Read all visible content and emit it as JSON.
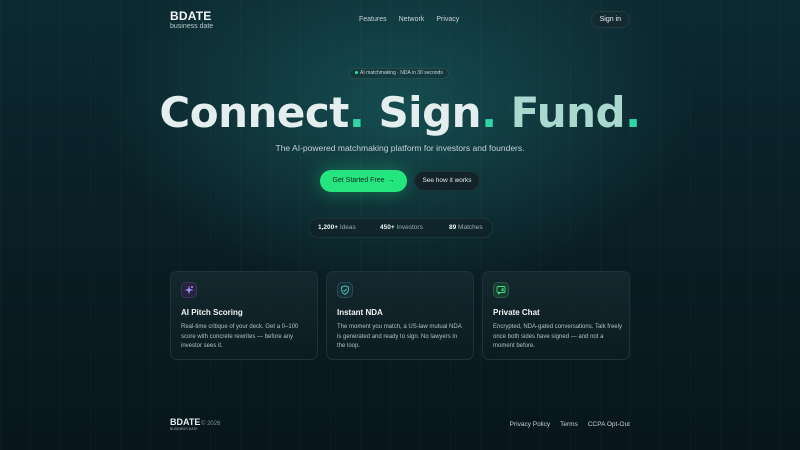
{
  "nav": {
    "logo": "BDATE",
    "logo_sub": "business date",
    "links": [
      "Features",
      "Network",
      "Privacy"
    ],
    "signin": "Sign in"
  },
  "badge": "AI matchmaking · NDA in 30 seconds",
  "hero": {
    "words": [
      "Connect",
      "Sign",
      "Fund"
    ],
    "dot": ".",
    "subtitle": "The AI-powered matchmaking platform for investors and founders."
  },
  "cta": {
    "primary": "Get Started Free",
    "secondary": "See how it works"
  },
  "stats": [
    {
      "value": "1,200+",
      "label": "Ideas"
    },
    {
      "value": "450+",
      "label": "Investors"
    },
    {
      "value": "89",
      "label": "Matches"
    }
  ],
  "cards": [
    {
      "icon": "sparkle-icon",
      "title": "AI Pitch Scoring",
      "desc": "Real-time critique of your deck. Get a 0–100 score with concrete rewrites — before any investor sees it."
    },
    {
      "icon": "shield-icon",
      "title": "Instant NDA",
      "desc": "The moment you match, a US-law mutual NDA is generated and ready to sign. No lawyers in the loop."
    },
    {
      "icon": "chat-icon",
      "title": "Private Chat",
      "desc": "Encrypted, NDA-gated conversations. Talk freely once both sides have signed — and not a moment before."
    }
  ],
  "footer": {
    "logo": "BDATE",
    "logo_sub": "BUSINESS DATE",
    "copyright": "© 2026",
    "links": [
      "Privacy Policy",
      "Terms",
      "CCPA Opt-Out"
    ]
  },
  "colors": {
    "accent": "#25e57f",
    "dot": "#2fd6a6",
    "background": "#0a1f26"
  }
}
